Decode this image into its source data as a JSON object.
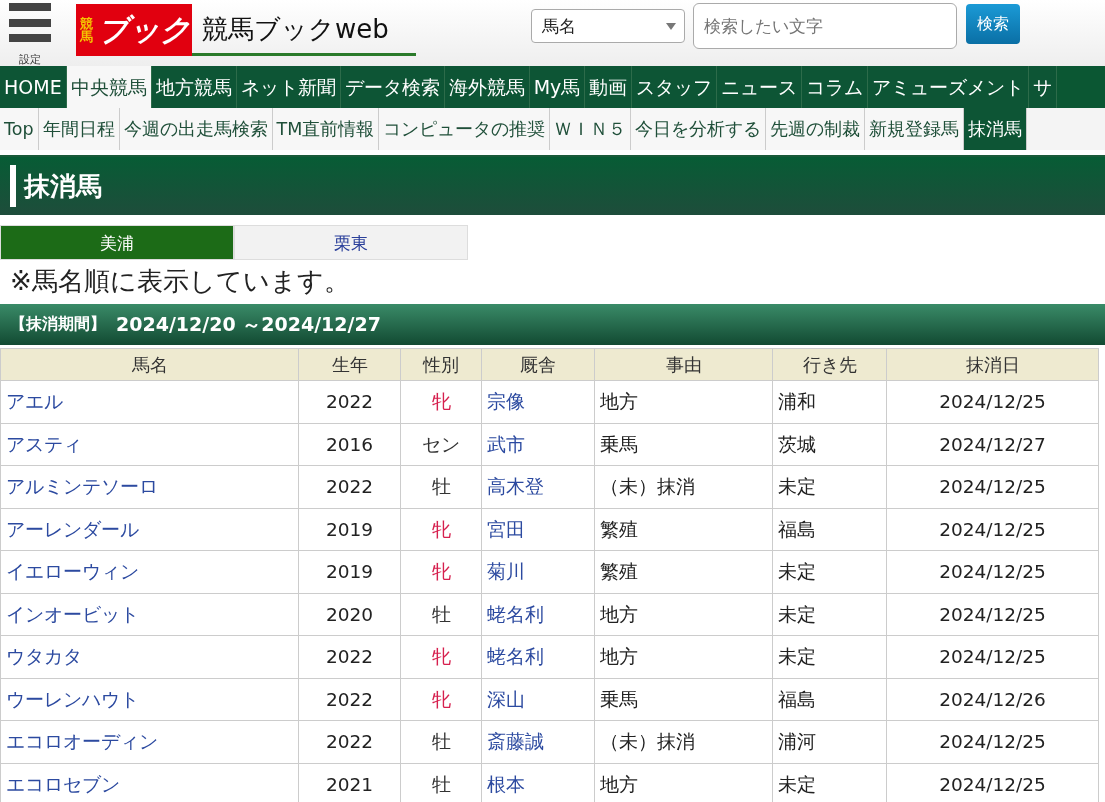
{
  "header": {
    "menu_label": "設定",
    "logo": {
      "small": "競馬",
      "big": "ブック"
    },
    "site_name": "競馬ブックweb",
    "search_type": "馬名",
    "search": {
      "placeholder": "検索したい文字"
    },
    "search_button": "検索"
  },
  "main_nav": [
    {
      "label": "HOME",
      "selected": false
    },
    {
      "label": "中央競馬",
      "selected": true
    },
    {
      "label": "地方競馬",
      "selected": false
    },
    {
      "label": "ネット新聞",
      "selected": false
    },
    {
      "label": "データ検索",
      "selected": false
    },
    {
      "label": "海外競馬",
      "selected": false
    },
    {
      "label": "My馬",
      "selected": false
    },
    {
      "label": "動画",
      "selected": false
    },
    {
      "label": "スタッフ",
      "selected": false
    },
    {
      "label": "ニュース",
      "selected": false
    },
    {
      "label": "コラム",
      "selected": false
    },
    {
      "label": "アミューズメント",
      "selected": false
    },
    {
      "label": "サ",
      "selected": false
    }
  ],
  "sub_nav": [
    {
      "label": "Top",
      "selected": false
    },
    {
      "label": "年間日程",
      "selected": false
    },
    {
      "label": "今週の出走馬検索",
      "selected": false
    },
    {
      "label": "TM直前情報",
      "selected": false
    },
    {
      "label": "コンピュータの推奨",
      "selected": false
    },
    {
      "label": "ＷＩＮ５",
      "selected": false
    },
    {
      "label": "今日を分析する",
      "selected": false
    },
    {
      "label": "先週の制裁",
      "selected": false
    },
    {
      "label": "新規登録馬",
      "selected": false
    },
    {
      "label": "抹消馬",
      "selected": true
    }
  ],
  "page_title": "抹消馬",
  "tabs": [
    {
      "label": "美浦",
      "selected": true
    },
    {
      "label": "栗東",
      "selected": false
    }
  ],
  "note": "※馬名順に表示しています。",
  "period": {
    "label": "【抹消期間】",
    "range": "2024/12/20 ～2024/12/27"
  },
  "table": {
    "columns": [
      "馬名",
      "生年",
      "性別",
      "厩舎",
      "事由",
      "行き先",
      "抹消日"
    ],
    "rows": [
      {
        "name": "アエル",
        "year": "2022",
        "sex": "牝",
        "color": "#d6204e",
        "trainer": "宗像",
        "reason": "地方",
        "destination": "浦和",
        "date": "2024/12/25"
      },
      {
        "name": "アスティ",
        "year": "2016",
        "sex": "セン",
        "color": "#333333",
        "trainer": "武市",
        "reason": "乗馬",
        "destination": "茨城",
        "date": "2024/12/27"
      },
      {
        "name": "アルミンテソーロ",
        "year": "2022",
        "sex": "牡",
        "color": "#333333",
        "trainer": "高木登",
        "reason": "（未）抹消",
        "destination": "未定",
        "date": "2024/12/25"
      },
      {
        "name": "アーレンダール",
        "year": "2019",
        "sex": "牝",
        "color": "#d6204e",
        "trainer": "宮田",
        "reason": "繁殖",
        "destination": "福島",
        "date": "2024/12/25"
      },
      {
        "name": "イエローウィン",
        "year": "2019",
        "sex": "牝",
        "color": "#d6204e",
        "trainer": "菊川",
        "reason": "繁殖",
        "destination": "未定",
        "date": "2024/12/25"
      },
      {
        "name": "インオービット",
        "year": "2020",
        "sex": "牡",
        "color": "#333333",
        "trainer": "蛯名利",
        "reason": "地方",
        "destination": "未定",
        "date": "2024/12/25"
      },
      {
        "name": "ウタカタ",
        "year": "2022",
        "sex": "牝",
        "color": "#d6204e",
        "trainer": "蛯名利",
        "reason": "地方",
        "destination": "未定",
        "date": "2024/12/25"
      },
      {
        "name": "ウーレンハウト",
        "year": "2022",
        "sex": "牝",
        "color": "#d6204e",
        "trainer": "深山",
        "reason": "乗馬",
        "destination": "福島",
        "date": "2024/12/26"
      },
      {
        "name": "エコロオーディン",
        "year": "2022",
        "sex": "牡",
        "color": "#333333",
        "trainer": "斎藤誠",
        "reason": "（未）抹消",
        "destination": "浦河",
        "date": "2024/12/25"
      },
      {
        "name": "エコロセブン",
        "year": "2021",
        "sex": "牡",
        "color": "#333333",
        "trainer": "根本",
        "reason": "地方",
        "destination": "未定",
        "date": "2024/12/25"
      }
    ]
  }
}
